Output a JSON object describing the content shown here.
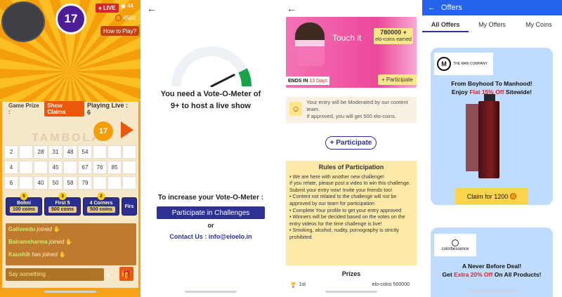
{
  "panel1": {
    "called_number_top": "17",
    "live_label": "LIVE",
    "viewers": "44",
    "coins": "4500",
    "how_to_play": "How to Play?",
    "game_prize_label": "Game Prize :",
    "show_claims": "Show Claims",
    "playing_live": "Playing Live : 6",
    "tent_text": "TAMBOLA",
    "current_number": "17",
    "ticket": [
      [
        "2",
        "",
        "28",
        "31",
        "48",
        "54",
        "",
        "",
        ""
      ],
      [
        "4",
        "",
        "",
        "45",
        "",
        "67",
        "76",
        "85",
        ""
      ],
      [
        "6",
        "",
        "40",
        "50",
        "58",
        "79",
        "",
        "",
        ""
      ]
    ],
    "claims": [
      {
        "name": "Bohni",
        "coins": "100 coins",
        "count": "5"
      },
      {
        "name": "First 5",
        "coins": "500 coins",
        "count": "3"
      },
      {
        "name": "4 Corners",
        "coins": "500 coins",
        "count": "2"
      },
      {
        "name": "Firs",
        "coins": "",
        "count": ""
      }
    ],
    "chat": [
      {
        "name": "Galiveedu",
        "action": "joined"
      },
      {
        "name": "Balramsharma",
        "action": "joined"
      },
      {
        "name": "Kaushik",
        "action": "has joined"
      }
    ],
    "say_placeholder": "Say something"
  },
  "panel2": {
    "vote_text_1": "You need a Vote-O-Meter of",
    "vote_text_2": "9+ to host a live show",
    "increase_text": "To increase your Vote-O-Meter :",
    "participate_button": "Participate in Challenges",
    "or_text": "or",
    "contact_text": "Contact Us : info@eloelo.in",
    "gauge_value": 0.85,
    "gauge_colors": {
      "track": "#e5e7eb",
      "fill": "#16a34a"
    }
  },
  "panel3": {
    "banner_title": "Touch it",
    "coins_earned_value": "780000 +",
    "coins_earned_label": "elo-coins earned",
    "ends_in_label": "ENDS IN",
    "ends_in_value": "13 Days",
    "participate_small": "+ Participate",
    "moderation_text": "Your entry will be Moderated by our content team.",
    "moderation_text_2": "If approved, you will get 500 elo-coins.",
    "participate_outline": "+ Participate",
    "rules_title": "Rules of Participation",
    "rules": [
      "• We are here with another new challenge!",
      "If you relate, please post a video to win this challenge.",
      "Submit your entry now! Invite your friends too!",
      "• Content not related to the challenge will not be approved by our team for participation",
      "• Complete Your profile to get your entry approved",
      "• Winners will be decided based on the votes on the entry videos for the time challenge is live!",
      "• Smoking, alcohol, nudity, pornography is strictly prohibited"
    ],
    "prizes_title": "Prizes",
    "prize_rank": "1st",
    "prize_value": "elo-coins 500000"
  },
  "panel4": {
    "header_title": "Offers",
    "tabs": [
      "All Offers",
      "My Offers",
      "My Coins"
    ],
    "card1": {
      "brand": "THE MAN COMPANY",
      "headline_1": "From Boyhood To Manhood!",
      "headline_2_a": "Enjoy ",
      "headline_2_b": "Flat 15% Off",
      "headline_2_c": " Sitewide!",
      "claim_label": "Claim for 1200"
    },
    "card2": {
      "brand": "colorbessence",
      "headline_1": "A Never Before Deal!",
      "headline_2_a": "Get ",
      "headline_2_b": "Extra 20% Off",
      "headline_2_c": " On All Products!"
    }
  }
}
